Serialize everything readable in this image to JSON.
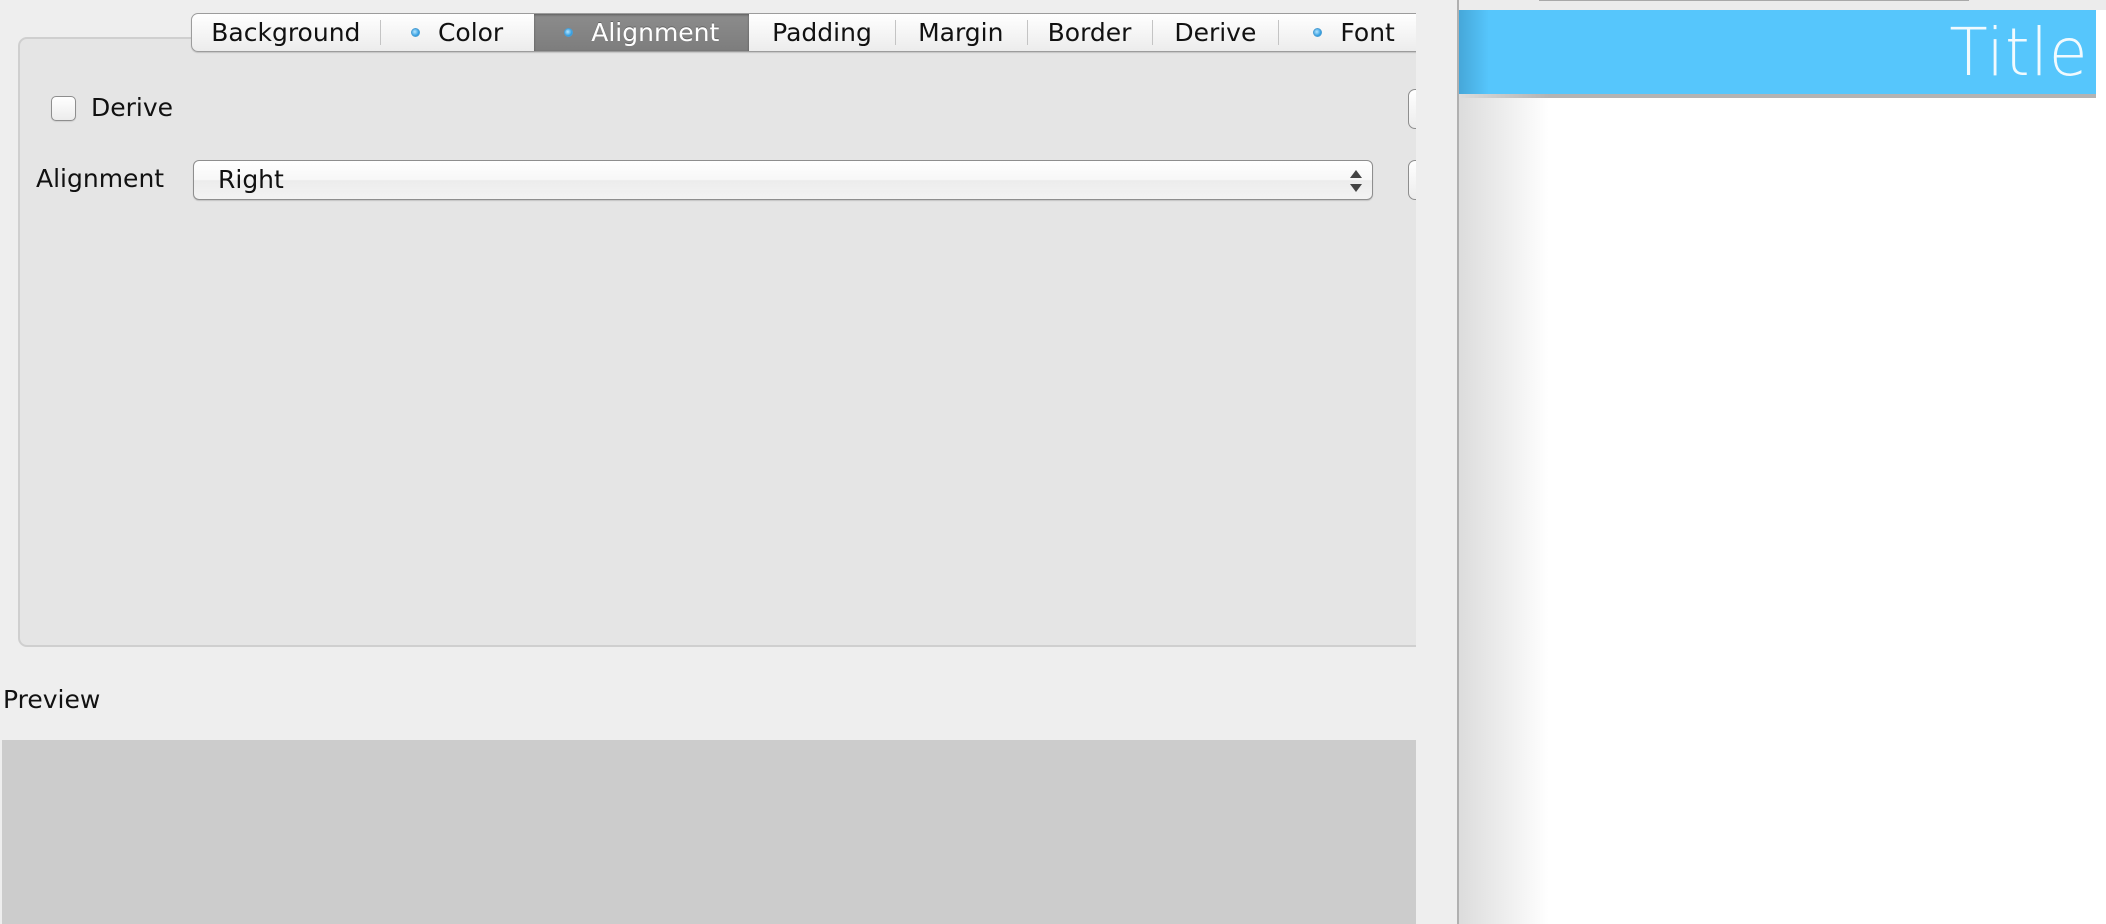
{
  "tabs": [
    {
      "label": "Background",
      "has_indicator": false,
      "active": false
    },
    {
      "label": "Color",
      "has_indicator": true,
      "active": false
    },
    {
      "label": "Alignment",
      "has_indicator": true,
      "active": true
    },
    {
      "label": "Padding",
      "has_indicator": false,
      "active": false
    },
    {
      "label": "Margin",
      "has_indicator": false,
      "active": false
    },
    {
      "label": "Border",
      "has_indicator": false,
      "active": false
    },
    {
      "label": "Derive",
      "has_indicator": false,
      "active": false
    },
    {
      "label": "Font",
      "has_indicator": true,
      "active": false
    }
  ],
  "alignment_panel": {
    "derive_checkbox": {
      "label": "Derive",
      "checked": false
    },
    "alignment_field": {
      "label": "Alignment",
      "value": "Right"
    }
  },
  "preview": {
    "label": "Preview"
  },
  "right_panel": {
    "title": "Title",
    "title_bar_color": "#56c6fc"
  },
  "colors": {
    "indicator_dot": "#2d9be0",
    "active_tab": "#858585"
  }
}
